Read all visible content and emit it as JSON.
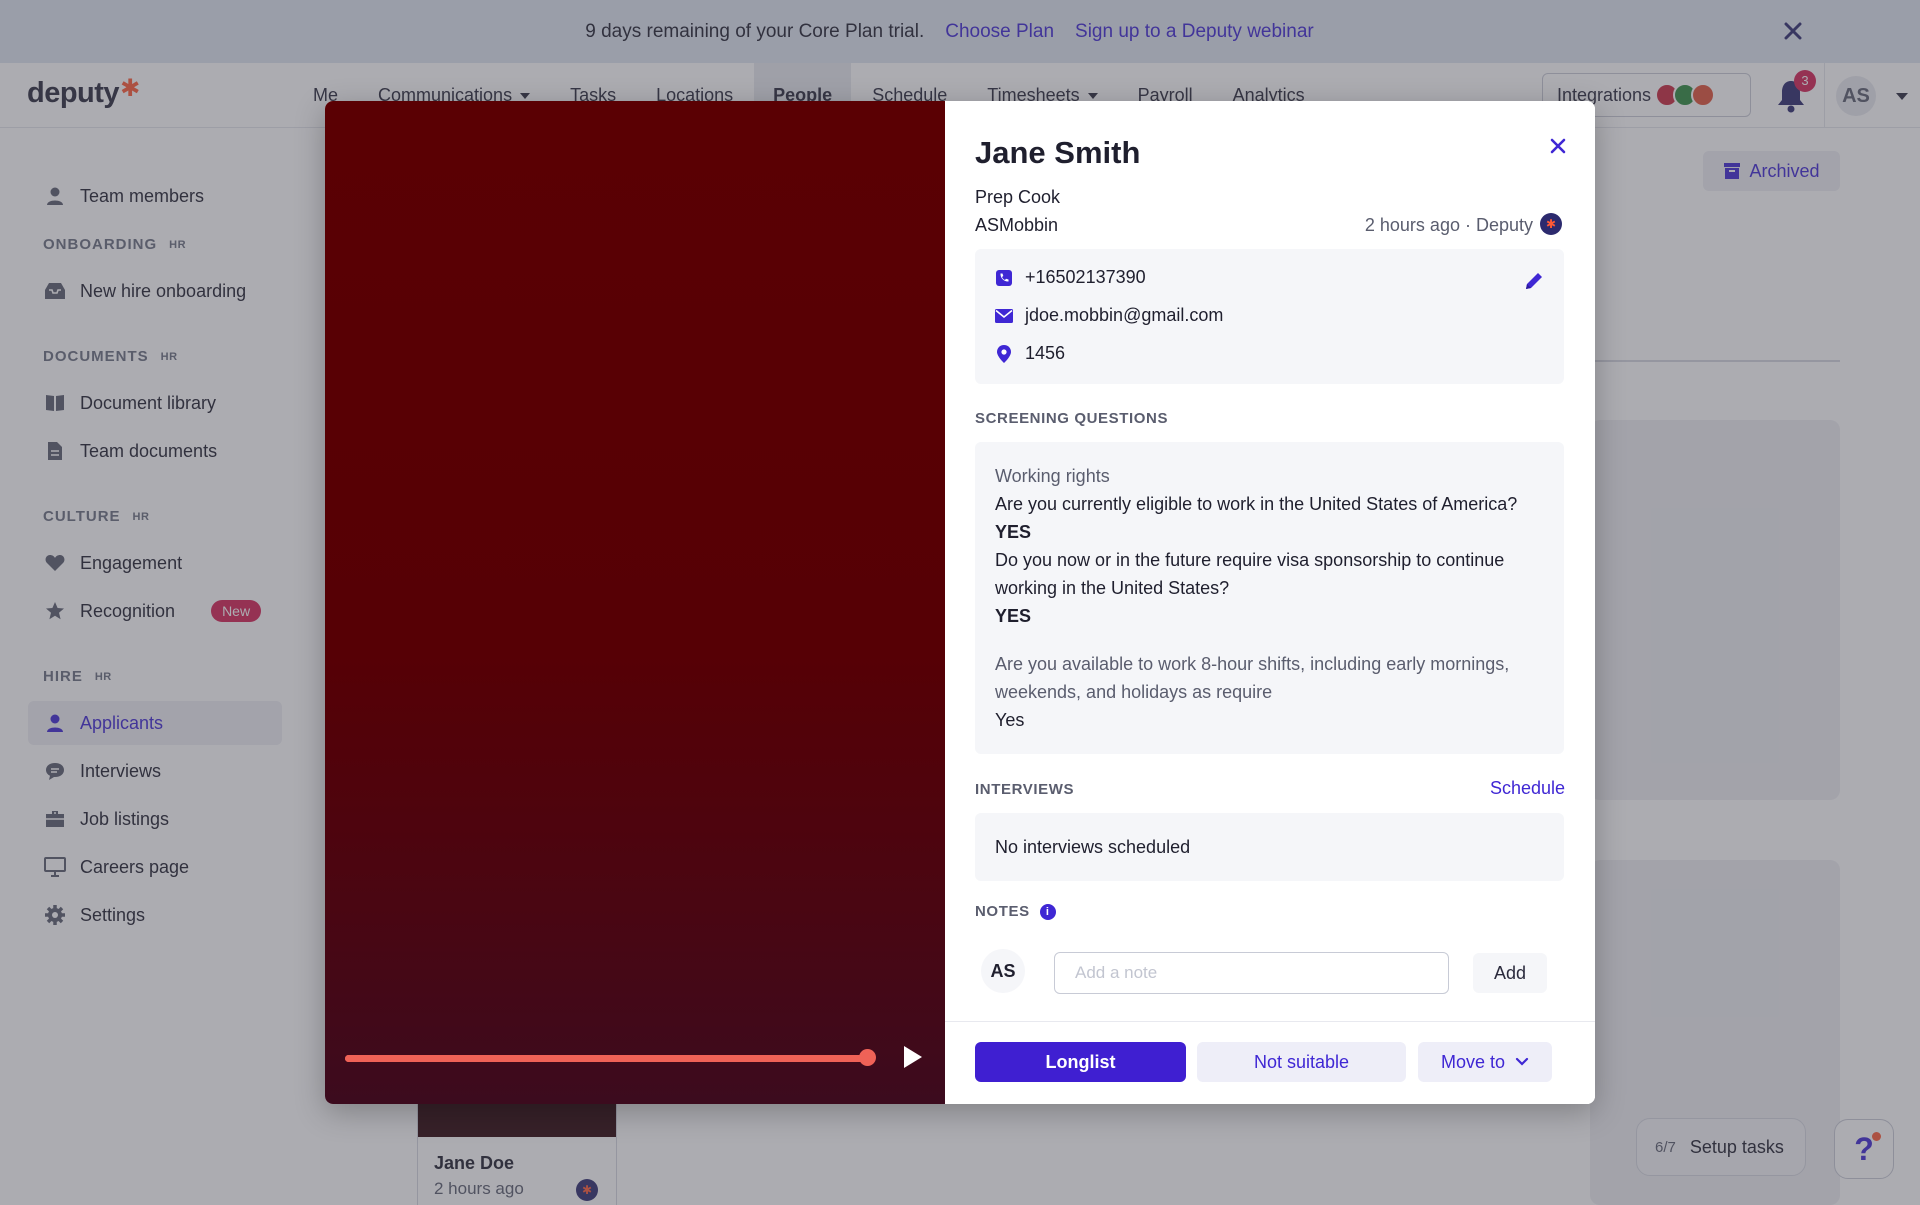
{
  "banner": {
    "message": "9 days remaining of your Core Plan trial.",
    "choose_plan": "Choose Plan",
    "webinar": "Sign up to a Deputy webinar"
  },
  "brand": {
    "logo": "deputy",
    "accent": "#ff5a36",
    "primary": "#3f27d4"
  },
  "nav": {
    "items": [
      "Me",
      "Communications",
      "Tasks",
      "Locations",
      "People",
      "Schedule",
      "Timesheets",
      "Payroll",
      "Analytics"
    ],
    "active": "People",
    "integrations_label": "Integrations",
    "notification_count": "3",
    "user_initials": "AS"
  },
  "sidebar": {
    "team_members": "Team members",
    "onboarding_head": "ONBOARDING",
    "new_hire_onboarding": "New hire onboarding",
    "documents_head": "DOCUMENTS",
    "document_library": "Document library",
    "team_documents": "Team documents",
    "culture_head": "CULTURE",
    "engagement": "Engagement",
    "recognition": "Recognition",
    "new_badge": "New",
    "hire_head": "HIRE",
    "applicants": "Applicants",
    "interviews": "Interviews",
    "job_listings": "Job listings",
    "careers_page": "Careers page",
    "settings": "Settings",
    "hr_tag": "HR"
  },
  "main": {
    "archived_label": "Archived",
    "card_name": "Jane Doe",
    "card_time": "2 hours ago",
    "setup_fraction": "6/7",
    "setup_label": "Setup tasks",
    "help_label": "?"
  },
  "video": {
    "progress": 1.0
  },
  "applicant": {
    "name": "Jane Smith",
    "role": "Prep Cook",
    "location": "ASMobbin",
    "source": "2 hours ago · Deputy",
    "phone": "+16502137390",
    "email": "jdoe.mobbin@gmail.com",
    "postcode": "1456"
  },
  "screening": {
    "heading": "SCREENING QUESTIONS",
    "group_title": "Working rights",
    "q1": "Are you currently eligible to work in the United States of America?",
    "a1": "YES",
    "q2": "Do you now or in the future require visa sponsorship to continue working in the United States?",
    "a2": "YES",
    "q3": "Are you available to work 8-hour shifts, including early mornings, weekends, and holidays as require",
    "a3": "Yes"
  },
  "interviews": {
    "heading": "INTERVIEWS",
    "schedule_link": "Schedule",
    "empty": "No interviews scheduled"
  },
  "notes": {
    "heading": "NOTES",
    "author_initials": "AS",
    "placeholder": "Add a note",
    "add_label": "Add"
  },
  "actions": {
    "longlist": "Longlist",
    "not_suitable": "Not suitable",
    "move_to": "Move to"
  }
}
